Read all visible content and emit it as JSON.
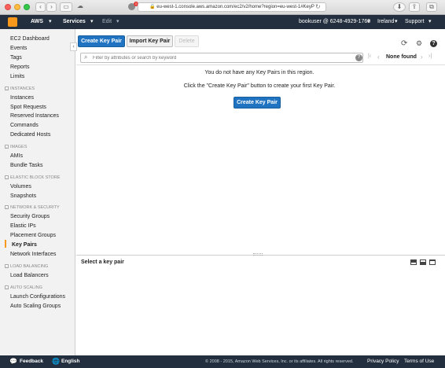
{
  "browser": {
    "url": "eu-west-1.console.aws.amazon.com/ec2/v2/home?region=eu-west-1#KeyP",
    "badge_count": "1"
  },
  "nav": {
    "brand": "AWS",
    "services": "Services",
    "edit": "Edit",
    "account": "bookuser @ 6248-4929-1760",
    "region": "Ireland",
    "support": "Support"
  },
  "sidebar": {
    "top_items": [
      "EC2 Dashboard",
      "Events",
      "Tags",
      "Reports",
      "Limits"
    ],
    "sections": [
      {
        "title": "INSTANCES",
        "items": [
          "Instances",
          "Spot Requests",
          "Reserved Instances",
          "Commands",
          "Dedicated Hosts"
        ]
      },
      {
        "title": "IMAGES",
        "items": [
          "AMIs",
          "Bundle Tasks"
        ]
      },
      {
        "title": "ELASTIC BLOCK STORE",
        "items": [
          "Volumes",
          "Snapshots"
        ]
      },
      {
        "title": "NETWORK & SECURITY",
        "items": [
          "Security Groups",
          "Elastic IPs",
          "Placement Groups",
          "Key Pairs",
          "Network Interfaces"
        ]
      },
      {
        "title": "LOAD BALANCING",
        "items": [
          "Load Balancers"
        ]
      },
      {
        "title": "AUTO SCALING",
        "items": [
          "Launch Configurations",
          "Auto Scaling Groups"
        ]
      }
    ],
    "active_item": "Key Pairs"
  },
  "toolbar": {
    "create_label": "Create Key Pair",
    "import_label": "Import Key Pair",
    "delete_label": "Delete"
  },
  "search": {
    "placeholder": "Filter by attributes or search by keyword"
  },
  "pagination": {
    "status": "None found"
  },
  "main": {
    "empty_message": "You do not have any Key Pairs in this region.",
    "hint_message": "Click the \"Create Key Pair\" button to create your first Key Pair.",
    "create_label": "Create Key Pair"
  },
  "detail": {
    "title": "Select a key pair"
  },
  "footer": {
    "feedback": "Feedback",
    "language": "English",
    "copyright": "© 2008 - 2015, Amazon Web Services, Inc. or its affiliates. All rights reserved.",
    "privacy": "Privacy Policy",
    "terms": "Terms of Use"
  },
  "colors": {
    "nav_bg": "#232f3e",
    "primary": "#1f73c1",
    "accent": "#f7981d"
  }
}
